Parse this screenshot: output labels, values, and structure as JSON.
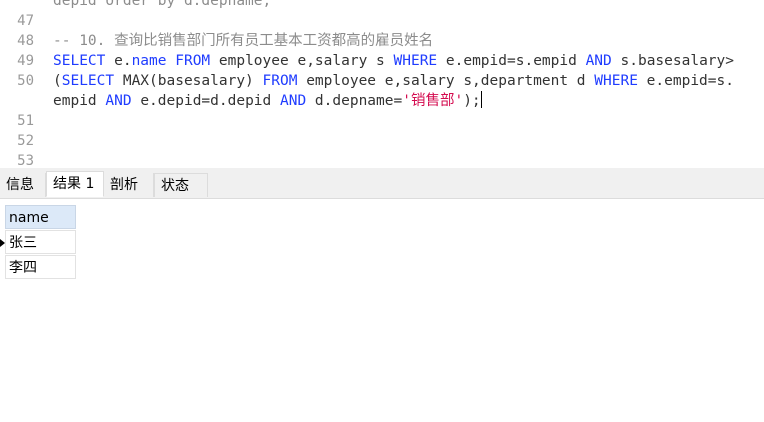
{
  "editor": {
    "lines": [
      {
        "no": "",
        "parts": [
          {
            "t": "depid order by d.depname;",
            "c": "cm"
          }
        ]
      },
      {
        "no": "47",
        "parts": []
      },
      {
        "no": "48",
        "parts": [
          {
            "t": "-- 10. 查询比销售部门所有员工基本工资都高的雇员姓名",
            "c": "cm"
          }
        ]
      },
      {
        "no": "49",
        "parts": [
          {
            "t": "SELECT ",
            "c": "kw"
          },
          {
            "t": "e.",
            "c": ""
          },
          {
            "t": "name ",
            "c": "kw"
          },
          {
            "t": "FROM ",
            "c": "kw"
          },
          {
            "t": "employee e,salary s ",
            "c": ""
          },
          {
            "t": "WHERE ",
            "c": "kw"
          },
          {
            "t": "e.empid=s.empid ",
            "c": ""
          },
          {
            "t": "AND ",
            "c": "kw"
          },
          {
            "t": "s.basesalary>",
            "c": ""
          }
        ]
      },
      {
        "no": "50",
        "parts": [
          {
            "t": "(",
            "c": ""
          },
          {
            "t": "SELECT ",
            "c": "kw"
          },
          {
            "t": "MAX(basesalary) ",
            "c": ""
          },
          {
            "t": "FROM ",
            "c": "kw"
          },
          {
            "t": "employee e,salary s,department d ",
            "c": ""
          },
          {
            "t": "WHERE ",
            "c": "kw"
          },
          {
            "t": "e.empid=s.",
            "c": ""
          }
        ]
      },
      {
        "no": "",
        "parts": [
          {
            "t": "empid ",
            "c": ""
          },
          {
            "t": "AND ",
            "c": "kw"
          },
          {
            "t": "e.depid=d.depid ",
            "c": ""
          },
          {
            "t": "AND ",
            "c": "kw"
          },
          {
            "t": "d.depname=",
            "c": ""
          },
          {
            "t": "'销售部'",
            "c": "str"
          },
          {
            "t": ");",
            "c": ""
          }
        ]
      },
      {
        "no": "51",
        "parts": []
      },
      {
        "no": "52",
        "parts": []
      },
      {
        "no": "53",
        "parts": []
      }
    ]
  },
  "tabs": [
    {
      "label": "信息",
      "active": false
    },
    {
      "label": "结果 1",
      "active": true
    },
    {
      "label": "剖析",
      "active": false
    },
    {
      "label": "状态",
      "active": false
    }
  ],
  "result": {
    "column": "name",
    "rows": [
      "张三",
      "李四"
    ]
  }
}
